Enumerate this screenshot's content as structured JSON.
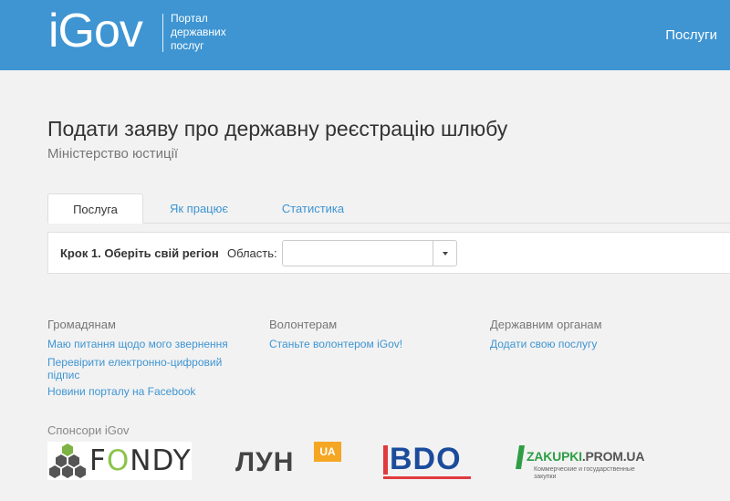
{
  "header": {
    "logo": "iGov",
    "logo_subtitle_lines": [
      "Портал",
      "державних",
      "послуг"
    ],
    "nav_services": "Послуги"
  },
  "page": {
    "title": "Подати заяву про державну реєстрацію шлюбу",
    "subtitle": "Міністерство юстиції"
  },
  "tabs": [
    {
      "label": "Послуга",
      "active": true
    },
    {
      "label": "Як працює",
      "active": false
    },
    {
      "label": "Статистика",
      "active": false
    }
  ],
  "step": {
    "label": "Крок 1. Оберіть свій регіон",
    "region_label": "Область:",
    "region_value": ""
  },
  "footer": {
    "columns": [
      {
        "title": "Громадянам",
        "links": [
          "Маю питання щодо мого звернення",
          "Перевірити електронно-цифровий підпис",
          "Новини порталу на Facebook"
        ]
      },
      {
        "title": "Волонтерам",
        "links": [
          "Станьте волонтером iGov!"
        ]
      },
      {
        "title": "Державним органам",
        "links": [
          "Додати свою послугу"
        ]
      }
    ],
    "sponsors_title": "Спонсори iGov",
    "sponsors": {
      "fondy": {
        "pre": "F",
        "o": "O",
        "post": "NDY"
      },
      "lun": {
        "text": "ЛУН",
        "badge": "UA"
      },
      "bdo": {
        "text": "BDO"
      },
      "zakupki": {
        "pre": "ZAKUPKI",
        "post": ".PROM.UA",
        "tagline": "Коммерческие и государственные закупки"
      }
    }
  },
  "colors": {
    "header_bg": "#3e95d2",
    "link": "#3e95d2",
    "page_bg": "#f2f2f2"
  }
}
